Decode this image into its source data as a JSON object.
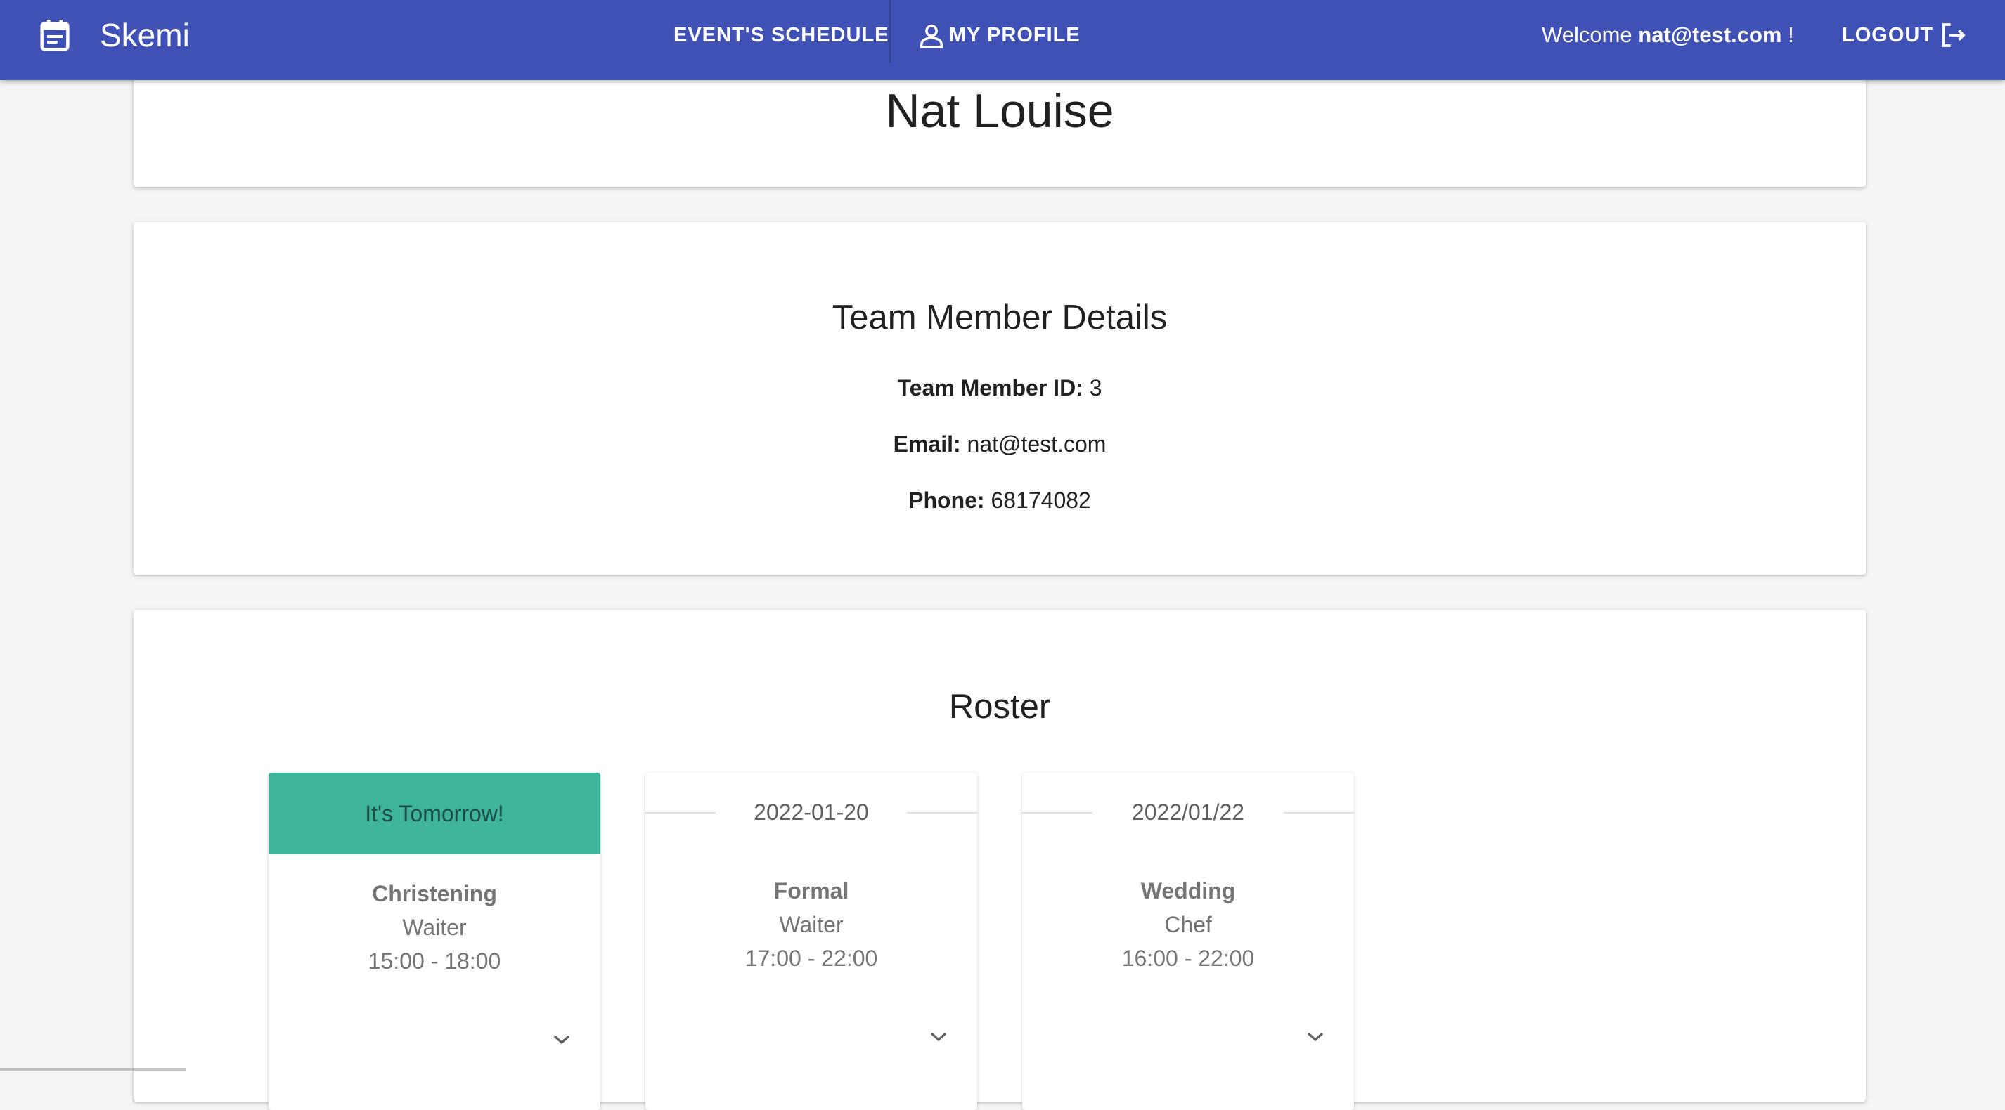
{
  "header": {
    "brand": "Skemi",
    "nav_schedule": "EVENT'S SCHEDULE",
    "nav_profile": "MY PROFILE",
    "welcome_prefix": "Welcome",
    "welcome_user": "nat@test.com",
    "welcome_suffix": "!",
    "logout": "LOGOUT",
    "color": "#3f51b5"
  },
  "profile": {
    "name": "Nat Louise"
  },
  "details": {
    "title": "Team Member Details",
    "id_label": "Team Member ID:",
    "id_value": "3",
    "email_label": "Email:",
    "email_value": "nat@test.com",
    "phone_label": "Phone:",
    "phone_value": "68174082"
  },
  "roster": {
    "title": "Roster",
    "accent": "#3eb59b",
    "events": [
      {
        "header": "It's Tomorrow!",
        "event": "Christening",
        "role": "Waiter",
        "time": "15:00 - 18:00"
      },
      {
        "header": "2022-01-20",
        "event": "Formal",
        "role": "Waiter",
        "time": "17:00 - 22:00"
      },
      {
        "header": "2022/01/22",
        "event": "Wedding",
        "role": "Chef",
        "time": "16:00 - 22:00"
      }
    ]
  },
  "icons": [
    "calendar-icon",
    "person-icon",
    "logout-icon",
    "chevron-down-icon"
  ]
}
